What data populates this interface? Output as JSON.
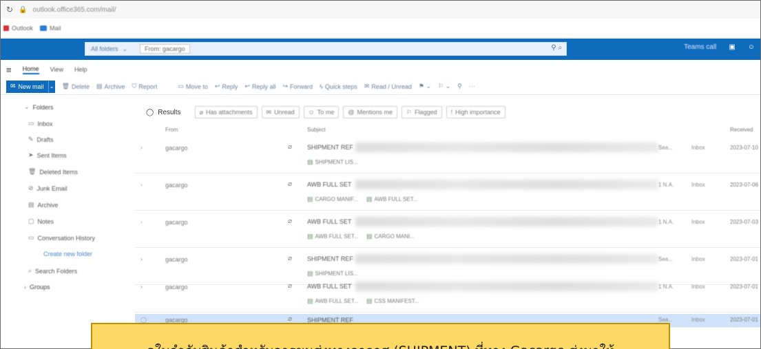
{
  "browser": {
    "url": "outlook.office365.com/mail/",
    "bookmarks": [
      "Outlook",
      "Mail"
    ]
  },
  "suite": {
    "search_scope": "All folders",
    "search_chip": "From: gacargo",
    "teams_label": "Teams call"
  },
  "ribbon": {
    "tabs": [
      "Home",
      "View",
      "Help"
    ],
    "new_mail": "New mail",
    "buttons": [
      "Delete",
      "Archive",
      "Report",
      "Move to",
      "Reply",
      "Reply all",
      "Forward",
      "Quick steps",
      "Read / Unread"
    ]
  },
  "leftnav": {
    "folders_label": "Folders",
    "items": [
      "Inbox",
      "Drafts",
      "Sent Items",
      "Deleted Items",
      "Junk Email",
      "Archive",
      "Notes",
      "Conversation History"
    ],
    "create_folder": "Create new folder",
    "search_folders": "Search Folders",
    "groups": "Groups"
  },
  "results_bar": {
    "label": "Results",
    "filters": [
      "Has attachments",
      "Unread",
      "To me",
      "Mentions me",
      "Flagged",
      "High importance"
    ]
  },
  "columns": {
    "from": "From",
    "subject": "Subject",
    "received": "Received"
  },
  "emails": [
    {
      "from": "gacargo",
      "subject": "SHIPMENT REF",
      "attachments": [
        "SHIPMENT LIS..."
      ],
      "size": "Sea...",
      "tag": "Inbox",
      "date": "2023-07-10"
    },
    {
      "from": "gacargo",
      "subject": "AWB FULL SET",
      "attachments": [
        "CARGO MANIF...",
        "AWB FULL SET..."
      ],
      "size": "1 N.A.",
      "tag": "Inbox",
      "date": "2023-07-06"
    },
    {
      "from": "gacargo",
      "subject": "AWB FULL SET",
      "attachments": [
        "AWB FULL SET...",
        "CARGO MANI..."
      ],
      "size": "1 N.A.",
      "tag": "Inbox",
      "date": "2023-07-03"
    },
    {
      "from": "gacargo",
      "subject": "SHIPMENT REF",
      "attachments": [
        "SHIPMENT LIS..."
      ],
      "size": "Sea...",
      "tag": "Inbox",
      "date": "2023-07-01"
    },
    {
      "from": "gacargo",
      "subject": "AWB FULL SET",
      "attachments": [
        "AWB FULL SET...",
        "CSS MANIFEST..."
      ],
      "size": "1 N.A.",
      "tag": "Inbox",
      "date": "2023-07-01"
    },
    {
      "from": "gacargo",
      "subject": "SHIPMENT REF",
      "attachments": [],
      "size": "Sea...",
      "tag": "Inbox",
      "date": "2023-07-01"
    }
  ],
  "caption": "ดูใบกำกับสินค้าสำหรับการขนส่งทางอากาศ (SHIPMENT) ที่ทาง Gacargo ส่งมาให้"
}
